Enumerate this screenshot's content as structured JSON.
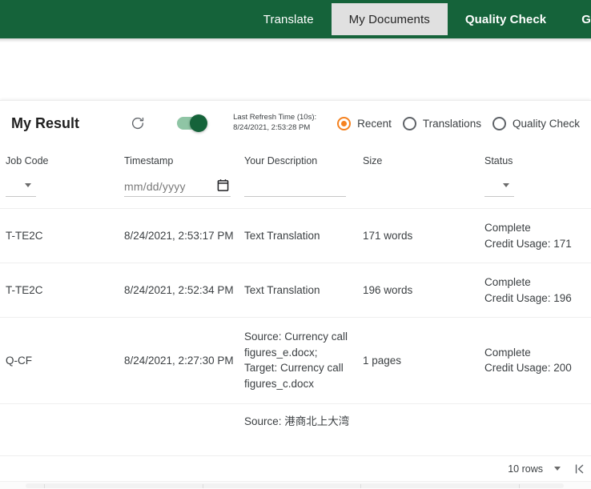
{
  "topnav": {
    "tabs": [
      {
        "label": "Translate",
        "active": false
      },
      {
        "label": "My Documents",
        "active": true
      },
      {
        "label": "Quality Check",
        "active": false
      },
      {
        "label": "G",
        "active": false
      }
    ],
    "background_color": "#15633a",
    "active_tab_color": "#e0e0e0"
  },
  "card": {
    "title": "My Result",
    "refresh_icon": "refresh-icon",
    "auto_refresh_toggle": {
      "state": "on",
      "on_color": "#15633a",
      "track_color": "#8fc5a5"
    },
    "refresh_info_line1": "Last Refresh Time (10s):",
    "refresh_info_line2": "8/24/2021, 2:53:28 PM",
    "radios": [
      {
        "label": "Recent",
        "checked": true
      },
      {
        "label": "Translations",
        "checked": false
      },
      {
        "label": "Quality Check",
        "checked": false
      }
    ],
    "radio_accent_color": "#f58220"
  },
  "table": {
    "headers": {
      "job_code": "Job Code",
      "timestamp": "Timestamp",
      "description": "Your Description",
      "size": "Size",
      "status": "Status"
    },
    "filters": {
      "job_code_value": "",
      "timestamp_placeholder": "mm/dd/yyyy",
      "timestamp_value": "",
      "description_value": "",
      "status_value": "",
      "calendar_icon": "calendar-icon"
    },
    "rows": [
      {
        "job_code": "T-TE2C",
        "timestamp": "8/24/2021, 2:53:17 PM",
        "description": "Text Translation",
        "size": "171 words",
        "status": "Complete\nCredit Usage: 171"
      },
      {
        "job_code": "T-TE2C",
        "timestamp": "8/24/2021, 2:52:34 PM",
        "description": "Text Translation",
        "size": "196 words",
        "status": "Complete\nCredit Usage: 196"
      },
      {
        "job_code": "Q-CF",
        "timestamp": "8/24/2021, 2:27:30 PM",
        "description": "Source: Currency call figures_e.docx;\nTarget: Currency call figures_c.docx",
        "size": "1 pages",
        "status": "Complete\nCredit Usage: 200"
      },
      {
        "job_code": "",
        "timestamp": "",
        "description": "Source: 港商北上大湾",
        "size": "",
        "status": ""
      }
    ]
  },
  "footer": {
    "rows_per_page": "10 rows",
    "rows_caret_icon": "chevron-down-icon",
    "first_page_icon": "first-page-icon"
  }
}
